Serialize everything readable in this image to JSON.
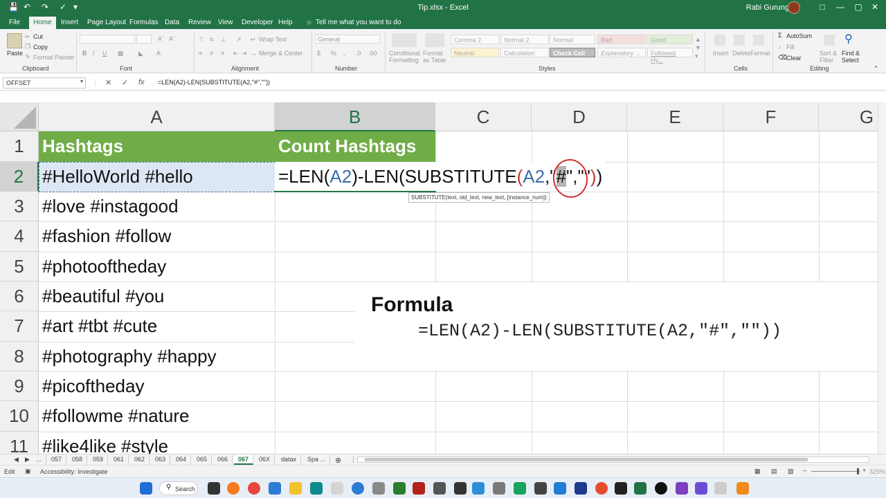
{
  "window": {
    "title": "Tip.xlsx - Excel",
    "user": "Rabi Gurung"
  },
  "tabs": [
    "File",
    "Home",
    "Insert",
    "Page Layout",
    "Formulas",
    "Data",
    "Review",
    "View",
    "Developer",
    "Help"
  ],
  "active_tab": "Home",
  "tell_me": "Tell me what you want to do",
  "ribbon": {
    "clipboard": {
      "paste": "Paste",
      "cut": "Cut",
      "copy": "Copy",
      "format_painter": "Format Painter",
      "label": "Clipboard"
    },
    "font": {
      "label": "Font"
    },
    "alignment": {
      "wrap": "Wrap Text",
      "merge": "Merge & Center",
      "label": "Alignment"
    },
    "number": {
      "format": "General",
      "label": "Number"
    },
    "styles": {
      "conditional": "Conditional Formatting",
      "format_table": "Format as Table",
      "cells": [
        "Comma 2",
        "Normal 2",
        "Normal",
        "Bad",
        "Good",
        "Neutral",
        "Calculation",
        "Check Cell",
        "Explanatory ...",
        "Followed Hy..."
      ],
      "label": "Styles"
    },
    "cells": {
      "insert": "Insert",
      "delete": "Delete",
      "format": "Format",
      "label": "Cells"
    },
    "editing": {
      "autosum": "AutoSum",
      "fill": "Fill",
      "clear": "Clear",
      "sort": "Sort & Filter",
      "find": "Find & Select",
      "label": "Editing"
    }
  },
  "formula_bar": {
    "name_box": "OFFSET",
    "formula": "=LEN(A2)-LEN(SUBSTITUTE(A2,\"#\",\"\"))"
  },
  "columns": [
    "A",
    "B",
    "C",
    "D",
    "E",
    "F",
    "G"
  ],
  "rows": [
    "1",
    "2",
    "3",
    "4",
    "5",
    "6",
    "7",
    "8",
    "9",
    "10",
    "11"
  ],
  "cells": {
    "A1": "Hashtags",
    "B1": "Count Hashtags",
    "A2": "#HelloWorld #hello",
    "A3": "#love #instagood",
    "A4": "#fashion #follow",
    "A5": "#photooftheday",
    "A6": "#beautiful #you",
    "A7": "#art #tbt #cute",
    "A8": "#photography #happy",
    "A9": "#picoftheday",
    "A10": "#followme #nature",
    "A11": "#like4like #style"
  },
  "editing_formula": {
    "p1": "=LEN(",
    "r1": "A2",
    "p2": ")-LEN(SUBSTITUTE",
    "p3": "(",
    "r2": "A2",
    "p4": ",\"",
    "p5": "#",
    "p6": "\",\"\"",
    "p7": ")",
    "p8": ")"
  },
  "tooltip": "SUBSTITUTE(text, old_text, new_text, [instance_num])",
  "overlay": {
    "title": "Formula",
    "formula": "=LEN(A2)-LEN(SUBSTITUTE(A2,\"#\",\"\"))"
  },
  "sheets": [
    "...",
    "057",
    "058",
    "059",
    "061",
    "062",
    "063",
    "064",
    "065",
    "066",
    "067",
    "06X",
    "datax",
    "Spa ..."
  ],
  "active_sheet": "067",
  "status": {
    "mode": "Edit",
    "accessibility": "Accessibility: Investigate",
    "zoom": "325%"
  },
  "taskbar": {
    "search": "Search"
  }
}
